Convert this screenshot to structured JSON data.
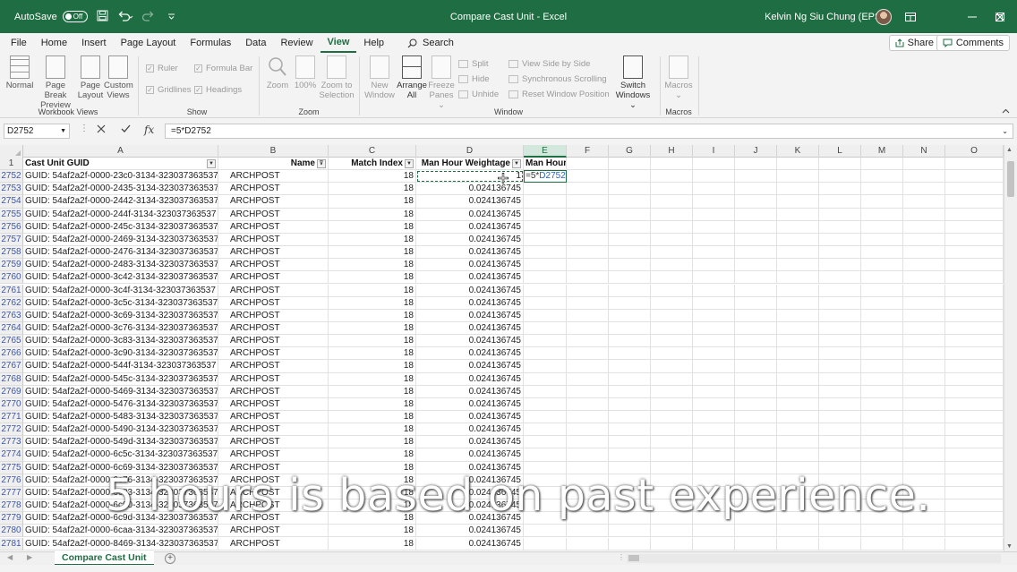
{
  "titlebar": {
    "autosave_label": "AutoSave",
    "autosave_state": "Off",
    "doc_title": "Compare Cast Unit  -  Excel",
    "user_name": "Kelvin Ng Siu Chung (EPS)",
    "save_icon": "save-icon",
    "undo_icon": "undo-icon",
    "redo_icon": "redo-icon"
  },
  "menu": {
    "tabs": [
      "File",
      "Home",
      "Insert",
      "Page Layout",
      "Formulas",
      "Data",
      "Review",
      "View",
      "Help"
    ],
    "active_tab": "View",
    "search_label": "Search",
    "share_label": "Share",
    "comments_label": "Comments"
  },
  "ribbon": {
    "workbook_views": {
      "group_label": "Workbook Views",
      "buttons": [
        {
          "label1": "Normal",
          "label2": ""
        },
        {
          "label1": "Page Break",
          "label2": "Preview"
        },
        {
          "label1": "Page",
          "label2": "Layout"
        },
        {
          "label1": "Custom",
          "label2": "Views"
        }
      ]
    },
    "show": {
      "group_label": "Show",
      "checks": [
        "Ruler",
        "Formula Bar",
        "Gridlines",
        "Headings"
      ]
    },
    "zoom": {
      "group_label": "Zoom",
      "buttons": [
        {
          "label1": "Zoom",
          "label2": ""
        },
        {
          "label1": "100%",
          "label2": ""
        },
        {
          "label1": "Zoom to",
          "label2": "Selection"
        }
      ]
    },
    "window": {
      "group_label": "Window",
      "buttons": [
        {
          "label1": "New",
          "label2": "Window"
        },
        {
          "label1": "Arrange",
          "label2": "All"
        },
        {
          "label1": "Freeze",
          "label2": "Panes"
        }
      ],
      "small": [
        "Split",
        "Hide",
        "Unhide",
        "View Side by Side",
        "Synchronous Scrolling",
        "Reset Window Position"
      ],
      "switch_label1": "Switch",
      "switch_label2": "Windows"
    },
    "macros": {
      "group_label": "Macros",
      "button_label": "Macros"
    }
  },
  "formula_bar": {
    "name_box": "D2752",
    "formula": "=5*D2752",
    "fx": "fx"
  },
  "grid": {
    "columns": [
      "A",
      "B",
      "C",
      "D",
      "E",
      "F",
      "G",
      "H",
      "I",
      "J",
      "K",
      "L",
      "M",
      "N",
      "O"
    ],
    "selected_column": "E",
    "header_row_number": "1",
    "headers": {
      "A": "Cast Unit GUID",
      "B": "Name",
      "C": "Match Index",
      "D": "Man Hour Weightage",
      "E": "Man Hour"
    },
    "rows": [
      {
        "n": "2752",
        "guid": "GUID: 54af2a2f-0000-23c0-3134-323037363537",
        "name": "ARCHPOST",
        "idx": "18",
        "wt": "1",
        "e": "=5*D2752"
      },
      {
        "n": "2753",
        "guid": "GUID: 54af2a2f-0000-2435-3134-323037363537",
        "name": "ARCHPOST",
        "idx": "18",
        "wt": "0.024136745",
        "e": ""
      },
      {
        "n": "2754",
        "guid": "GUID: 54af2a2f-0000-2442-3134-323037363537",
        "name": "ARCHPOST",
        "idx": "18",
        "wt": "0.024136745",
        "e": ""
      },
      {
        "n": "2755",
        "guid": "GUID: 54af2a2f-0000-244f-3134-323037363537",
        "name": "ARCHPOST",
        "idx": "18",
        "wt": "0.024136745",
        "e": ""
      },
      {
        "n": "2756",
        "guid": "GUID: 54af2a2f-0000-245c-3134-323037363537",
        "name": "ARCHPOST",
        "idx": "18",
        "wt": "0.024136745",
        "e": ""
      },
      {
        "n": "2757",
        "guid": "GUID: 54af2a2f-0000-2469-3134-323037363537",
        "name": "ARCHPOST",
        "idx": "18",
        "wt": "0.024136745",
        "e": ""
      },
      {
        "n": "2758",
        "guid": "GUID: 54af2a2f-0000-2476-3134-323037363537",
        "name": "ARCHPOST",
        "idx": "18",
        "wt": "0.024136745",
        "e": ""
      },
      {
        "n": "2759",
        "guid": "GUID: 54af2a2f-0000-2483-3134-323037363537",
        "name": "ARCHPOST",
        "idx": "18",
        "wt": "0.024136745",
        "e": ""
      },
      {
        "n": "2760",
        "guid": "GUID: 54af2a2f-0000-3c42-3134-323037363537",
        "name": "ARCHPOST",
        "idx": "18",
        "wt": "0.024136745",
        "e": ""
      },
      {
        "n": "2761",
        "guid": "GUID: 54af2a2f-0000-3c4f-3134-323037363537",
        "name": "ARCHPOST",
        "idx": "18",
        "wt": "0.024136745",
        "e": ""
      },
      {
        "n": "2762",
        "guid": "GUID: 54af2a2f-0000-3c5c-3134-323037363537",
        "name": "ARCHPOST",
        "idx": "18",
        "wt": "0.024136745",
        "e": ""
      },
      {
        "n": "2763",
        "guid": "GUID: 54af2a2f-0000-3c69-3134-323037363537",
        "name": "ARCHPOST",
        "idx": "18",
        "wt": "0.024136745",
        "e": ""
      },
      {
        "n": "2764",
        "guid": "GUID: 54af2a2f-0000-3c76-3134-323037363537",
        "name": "ARCHPOST",
        "idx": "18",
        "wt": "0.024136745",
        "e": ""
      },
      {
        "n": "2765",
        "guid": "GUID: 54af2a2f-0000-3c83-3134-323037363537",
        "name": "ARCHPOST",
        "idx": "18",
        "wt": "0.024136745",
        "e": ""
      },
      {
        "n": "2766",
        "guid": "GUID: 54af2a2f-0000-3c90-3134-323037363537",
        "name": "ARCHPOST",
        "idx": "18",
        "wt": "0.024136745",
        "e": ""
      },
      {
        "n": "2767",
        "guid": "GUID: 54af2a2f-0000-544f-3134-323037363537",
        "name": "ARCHPOST",
        "idx": "18",
        "wt": "0.024136745",
        "e": ""
      },
      {
        "n": "2768",
        "guid": "GUID: 54af2a2f-0000-545c-3134-323037363537",
        "name": "ARCHPOST",
        "idx": "18",
        "wt": "0.024136745",
        "e": ""
      },
      {
        "n": "2769",
        "guid": "GUID: 54af2a2f-0000-5469-3134-323037363537",
        "name": "ARCHPOST",
        "idx": "18",
        "wt": "0.024136745",
        "e": ""
      },
      {
        "n": "2770",
        "guid": "GUID: 54af2a2f-0000-5476-3134-323037363537",
        "name": "ARCHPOST",
        "idx": "18",
        "wt": "0.024136745",
        "e": ""
      },
      {
        "n": "2771",
        "guid": "GUID: 54af2a2f-0000-5483-3134-323037363537",
        "name": "ARCHPOST",
        "idx": "18",
        "wt": "0.024136745",
        "e": ""
      },
      {
        "n": "2772",
        "guid": "GUID: 54af2a2f-0000-5490-3134-323037363537",
        "name": "ARCHPOST",
        "idx": "18",
        "wt": "0.024136745",
        "e": ""
      },
      {
        "n": "2773",
        "guid": "GUID: 54af2a2f-0000-549d-3134-323037363537",
        "name": "ARCHPOST",
        "idx": "18",
        "wt": "0.024136745",
        "e": ""
      },
      {
        "n": "2774",
        "guid": "GUID: 54af2a2f-0000-6c5c-3134-323037363537",
        "name": "ARCHPOST",
        "idx": "18",
        "wt": "0.024136745",
        "e": ""
      },
      {
        "n": "2775",
        "guid": "GUID: 54af2a2f-0000-6c69-3134-323037363537",
        "name": "ARCHPOST",
        "idx": "18",
        "wt": "0.024136745",
        "e": ""
      },
      {
        "n": "2776",
        "guid": "GUID: 54af2a2f-0000-6c76-3134-323037363537",
        "name": "ARCHPOST",
        "idx": "18",
        "wt": "0.024136745",
        "e": ""
      },
      {
        "n": "2777",
        "guid": "GUID: 54af2a2f-0000-6c83-3134-323037363537",
        "name": "ARCHPOST",
        "idx": "18",
        "wt": "0.024136745",
        "e": ""
      },
      {
        "n": "2778",
        "guid": "GUID: 54af2a2f-0000-6c90-3134-323037363537",
        "name": "ARCHPOST",
        "idx": "18",
        "wt": "0.024136745",
        "e": ""
      },
      {
        "n": "2779",
        "guid": "GUID: 54af2a2f-0000-6c9d-3134-323037363537",
        "name": "ARCHPOST",
        "idx": "18",
        "wt": "0.024136745",
        "e": ""
      },
      {
        "n": "2780",
        "guid": "GUID: 54af2a2f-0000-6caa-3134-323037363537",
        "name": "ARCHPOST",
        "idx": "18",
        "wt": "0.024136745",
        "e": ""
      },
      {
        "n": "2781",
        "guid": "GUID: 54af2a2f-0000-8469-3134-323037363537",
        "name": "ARCHPOST",
        "idx": "18",
        "wt": "0.024136745",
        "e": ""
      }
    ]
  },
  "sheets": {
    "active": "Compare Cast Unit"
  },
  "caption": "5 hours is based on past experience.",
  "colors": {
    "excel_green": "#1f6e43",
    "header_bg": "#efefef",
    "row_number_blue": "#3c57a8"
  }
}
